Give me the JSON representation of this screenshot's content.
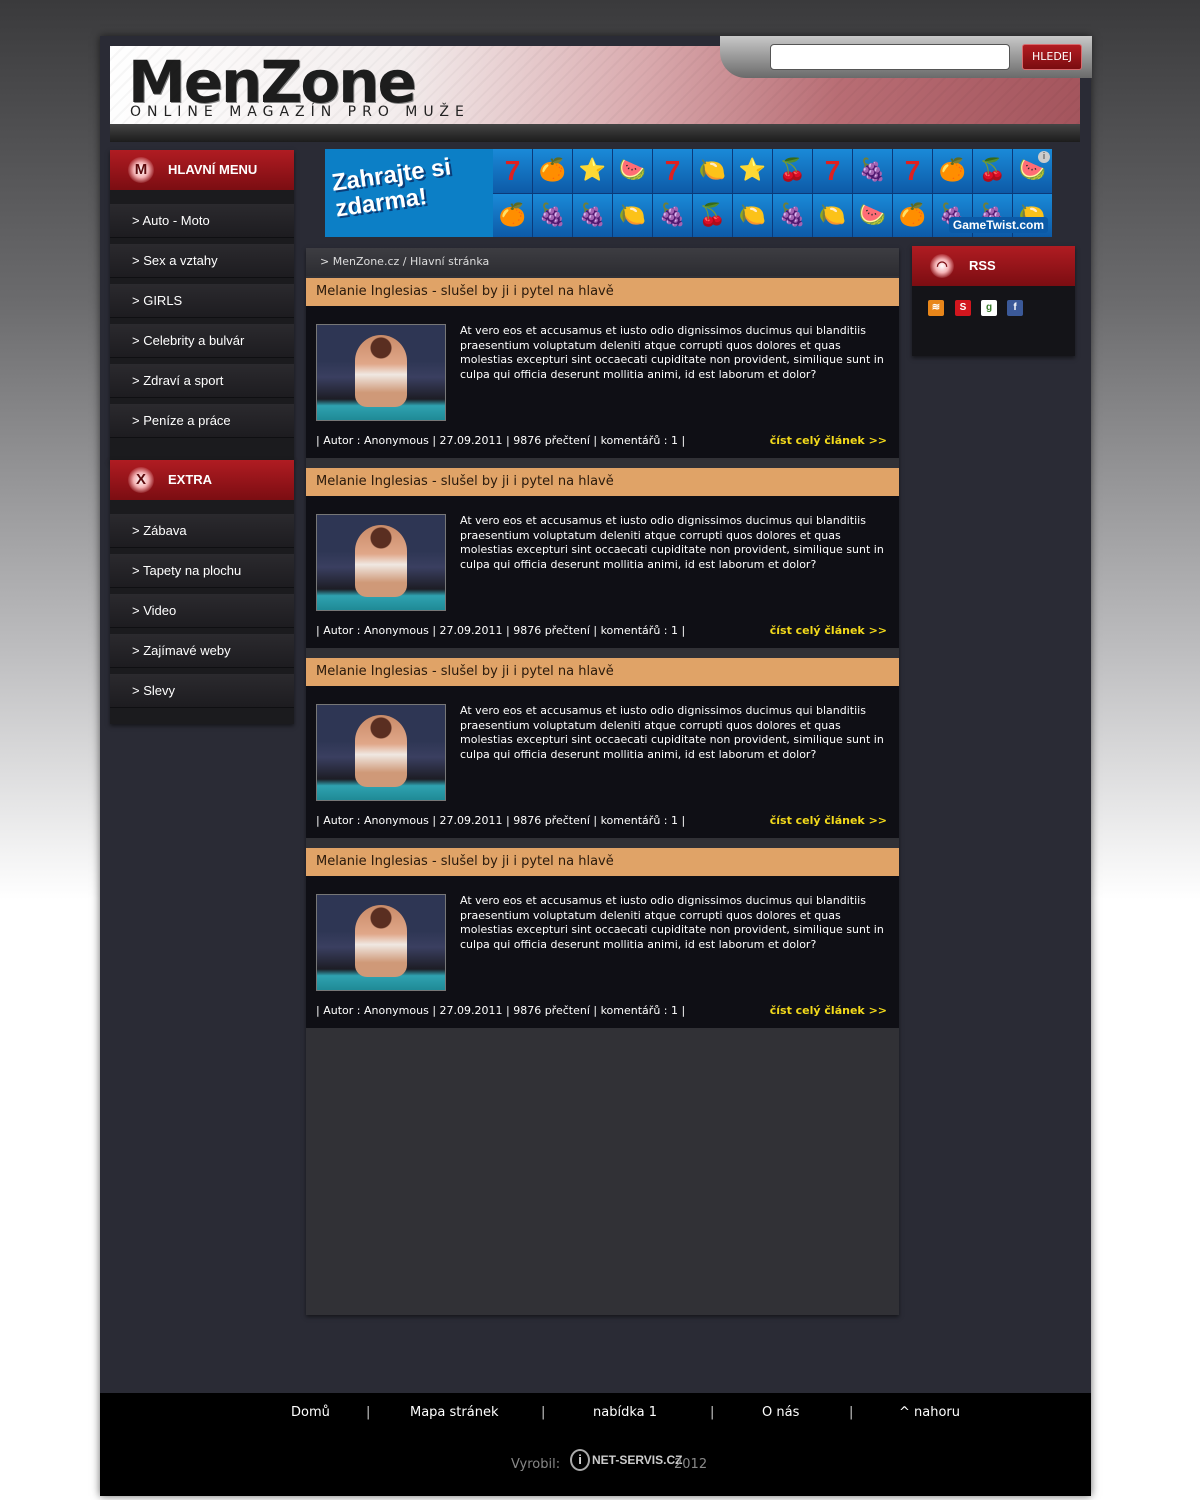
{
  "header": {
    "logo": "MenZone",
    "tagline": "ONLINE MAGAZÍN PRO MUŽE",
    "search": {
      "value": "",
      "button_label": "HLEDEJ"
    }
  },
  "sidebar": {
    "main_menu": {
      "title": "HLAVNÍ MENU",
      "icon_letter": "M",
      "items": [
        {
          "label": "> Auto - Moto"
        },
        {
          "label": "> Sex a vztahy"
        },
        {
          "label": "> GIRLS"
        },
        {
          "label": "> Celebrity a bulvár"
        },
        {
          "label": "> Zdraví a sport"
        },
        {
          "label": "> Peníze a práce"
        }
      ]
    },
    "extra_menu": {
      "title": "EXTRA",
      "icon_letter": "X",
      "items": [
        {
          "label": "> Zábava"
        },
        {
          "label": "> Tapety na plochu"
        },
        {
          "label": "> Video"
        },
        {
          "label": "> Zajímavé weby"
        },
        {
          "label": "> Slevy"
        }
      ]
    }
  },
  "banner": {
    "slogan": "Zahrajte si zdarma!",
    "brand": "GameTwist.com",
    "reels": [
      "7",
      "🍊",
      "⭐",
      "🍉",
      "7",
      "🍋",
      "⭐",
      "🍒",
      "7",
      "🍇",
      "7",
      "🍊",
      "🍒",
      "🍉",
      "🍊",
      "🍇",
      "🍇",
      "🍋",
      "🍇",
      "🍒",
      "🍋",
      "🍇",
      "🍋",
      "🍉",
      "🍊",
      "🍇",
      "🍇",
      "🍋"
    ]
  },
  "breadcrumb": {
    "home": "> MenZone.cz",
    "separator": "/",
    "current": "Hlavní stránka"
  },
  "articles": [
    {
      "title": "Melanie Inglesias - slušel by ji i pytel na hlavě",
      "text": "At vero eos et accusamus et iusto odio dignissimos ducimus qui blanditiis praesentium voluptatum deleniti atque corrupti quos dolores et quas molestias excepturi sint occaecati cupiditate non provident, similique sunt in culpa qui officia deserunt mollitia animi, id est laborum et dolor?",
      "meta": "| Autor : Anonymous | 27.09.2011 | 9876 přečtení | komentářů : 1 |",
      "more": "číst celý článek >>"
    },
    {
      "title": "Melanie Inglesias - slušel by ji i pytel na hlavě",
      "text": "At vero eos et accusamus et iusto odio dignissimos ducimus qui blanditiis praesentium voluptatum deleniti atque corrupti quos dolores et quas molestias excepturi sint occaecati cupiditate non provident, similique sunt in culpa qui officia deserunt mollitia animi, id est laborum et dolor?",
      "meta": "| Autor : Anonymous | 27.09.2011 | 9876 přečtení | komentářů : 1 |",
      "more": "číst celý článek >>"
    },
    {
      "title": "Melanie Inglesias - slušel by ji i pytel na hlavě",
      "text": "At vero eos et accusamus et iusto odio dignissimos ducimus qui blanditiis praesentium voluptatum deleniti atque corrupti quos dolores et quas molestias excepturi sint occaecati cupiditate non provident, similique sunt in culpa qui officia deserunt mollitia animi, id est laborum et dolor?",
      "meta": "| Autor : Anonymous | 27.09.2011 | 9876 přečtení | komentářů : 1 |",
      "more": "číst celý článek >>"
    },
    {
      "title": "Melanie Inglesias - slušel by ji i pytel na hlavě",
      "text": "At vero eos et accusamus et iusto odio dignissimos ducimus qui blanditiis praesentium voluptatum deleniti atque corrupti quos dolores et quas molestias excepturi sint occaecati cupiditate non provident, similique sunt in culpa qui officia deserunt mollitia animi, id est laborum et dolor?",
      "meta": "| Autor : Anonymous | 27.09.2011 | 9876 přečtení | komentářů : 1 |",
      "more": "číst celý článek >>"
    }
  ],
  "rss": {
    "title": "RSS",
    "icons": [
      "rss-feed-icon",
      "seznam-icon",
      "google-icon",
      "facebook-icon"
    ]
  },
  "footer": {
    "links": [
      "Domů",
      "Mapa stránek",
      "nabídka 1",
      "O nás",
      "^ nahoru"
    ],
    "separator": "|",
    "credit_label": "Vyrobil:",
    "credit_logo": "NET-SERVIS.CZ",
    "credit_year": "2012"
  },
  "colors": {
    "accent_red": "#9a151b",
    "article_title_bg": "#e0a367",
    "read_more": "#f3da1b",
    "page_bg": "#2a2b35"
  }
}
